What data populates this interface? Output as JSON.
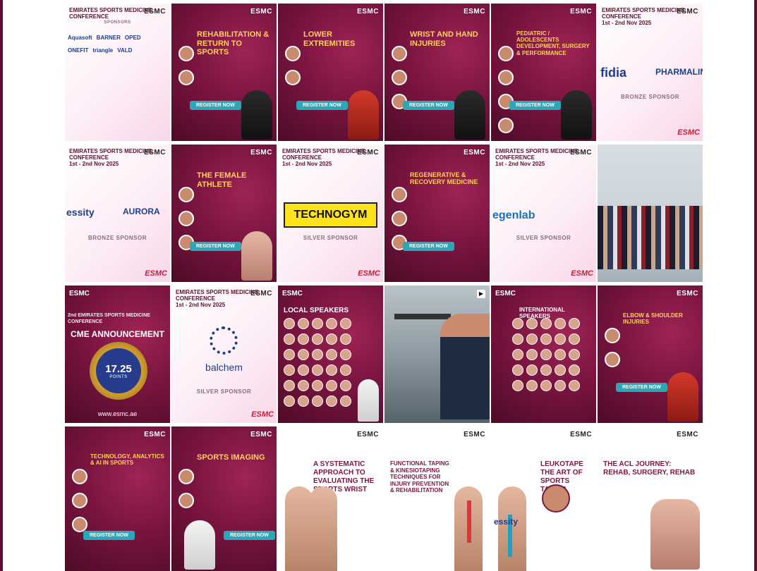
{
  "colors": {
    "brand_maroon": "#7a1440",
    "accent_gold": "#ffd15a",
    "button_teal": "#2aa8b8",
    "sponsor_blue": "#1b3e8e"
  },
  "posts": [
    {
      "id": "r1c1",
      "kind": "sponsors",
      "header": "EMIRATES SPORTS MEDICINE CONFERENCE",
      "label": "SPONSORS",
      "names": [
        "Aquasoft",
        "BARNER",
        "OPED",
        "ONEFIT",
        "triangle",
        "VALD"
      ]
    },
    {
      "id": "r1c2",
      "kind": "session",
      "title": "REHABILITATION & RETURN TO SPORTS",
      "button": "REGISTER NOW"
    },
    {
      "id": "r1c3",
      "kind": "session",
      "title": "LOWER EXTREMITIES",
      "button": "REGISTER NOW"
    },
    {
      "id": "r1c4",
      "kind": "session",
      "title": "WRIST AND HAND INJURIES",
      "button": "REGISTER NOW"
    },
    {
      "id": "r1c5",
      "kind": "session",
      "title": "PEDIATRIC / ADOLESCENTS DEVELOPMENT, SURGERY & PERFORMANCE",
      "button": "REGISTER NOW"
    },
    {
      "id": "r1c6",
      "kind": "sponsor",
      "header": "EMIRATES SPORTS MEDICINE CONFERENCE",
      "dates": "1st - 2nd Nov 2025",
      "main1": "fidia",
      "main2": "PHARMALIN",
      "label": "BRONZE SPONSOR"
    },
    {
      "id": "r2c1",
      "kind": "sponsor",
      "header": "EMIRATES SPORTS MEDICINE CONFERENCE",
      "dates": "1st - 2nd Nov 2025",
      "main1": "essity",
      "main2": "AURORA",
      "label": "BRONZE SPONSOR"
    },
    {
      "id": "r2c2",
      "kind": "session",
      "title": "THE FEMALE ATHLETE",
      "button": "REGISTER NOW"
    },
    {
      "id": "r2c3",
      "kind": "sponsor",
      "header": "EMIRATES SPORTS MEDICINE CONFERENCE",
      "dates": "1st - 2nd Nov 2025",
      "main1": "TECHNOGYM",
      "label": "SILVER SPONSOR"
    },
    {
      "id": "r2c4",
      "kind": "session",
      "title": "REGENERATIVE & RECOVERY MEDICINE",
      "button": "REGISTER NOW"
    },
    {
      "id": "r2c5",
      "kind": "sponsor",
      "header": "EMIRATES SPORTS MEDICINE CONFERENCE",
      "dates": "1st - 2nd Nov 2025",
      "main1": "egenlab",
      "label": "SILVER SPONSOR"
    },
    {
      "id": "r2c6",
      "kind": "photo"
    },
    {
      "id": "r3c1",
      "kind": "cme",
      "header": "2nd EMIRATES SPORTS MEDICINE CONFERENCE",
      "title": "CME ANNOUNCEMENT",
      "points": "17.25",
      "points_label": "POINTS",
      "url": "www.esmc.ae"
    },
    {
      "id": "r3c2",
      "kind": "sponsor",
      "header": "EMIRATES SPORTS MEDICINE CONFERENCE",
      "dates": "1st - 2nd Nov 2025",
      "main1": "balchem",
      "label": "SILVER SPONSOR"
    },
    {
      "id": "r3c3",
      "kind": "speakers",
      "title": "LOCAL SPEAKERS"
    },
    {
      "id": "r3c4",
      "kind": "video"
    },
    {
      "id": "r3c5",
      "kind": "speakers",
      "title": "INTERNATIONAL SPEAKERS"
    },
    {
      "id": "r3c6",
      "kind": "session",
      "title": "ELBOW & SHOULDER INJURIES",
      "button": "REGISTER NOW"
    },
    {
      "id": "r4c1",
      "kind": "session",
      "title": "TECHNOLOGY, ANALYTICS & AI IN SPORTS",
      "button": "REGISTER NOW"
    },
    {
      "id": "r4c2",
      "kind": "session",
      "title": "SPORTS IMAGING",
      "button": "REGISTER NOW"
    },
    {
      "id": "r4c3",
      "kind": "article",
      "title": "A SYSTEMATIC APPROACH TO EVALUATING THE SPORTS WRIST"
    },
    {
      "id": "r4c4",
      "kind": "article",
      "title": "FUNCTIONAL TAPING & KINESIOTAPING TECHNIQUES FOR INJURY PREVENTION & REHABILITATION"
    },
    {
      "id": "r4c5",
      "kind": "article",
      "title": "LEUKOTAPE THE ART OF SPORTS TAPING",
      "main1": "essity"
    },
    {
      "id": "r4c6",
      "kind": "article",
      "title": "THE ACL JOURNEY: REHAB, SURGERY, REHAB"
    }
  ],
  "logo": {
    "short": "ESMC",
    "badge": "ESMC"
  }
}
